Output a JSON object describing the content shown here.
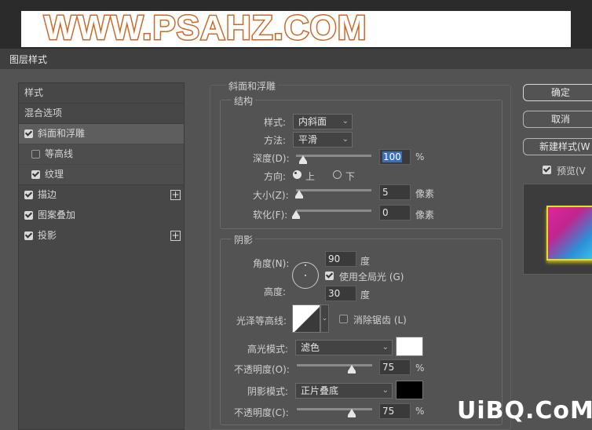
{
  "banner": {
    "text": "WWW.PSAHZ.COM"
  },
  "window": {
    "title": "图层样式"
  },
  "left_panel": {
    "items": [
      {
        "label": "样式"
      },
      {
        "label": "混合选项"
      },
      {
        "label": "斜面和浮雕",
        "checked": true
      },
      {
        "label": "等高线",
        "checked": false
      },
      {
        "label": "纹理",
        "checked": true
      },
      {
        "label": "描边",
        "checked": true
      },
      {
        "label": "图案叠加",
        "checked": true
      },
      {
        "label": "投影",
        "checked": true
      }
    ],
    "plus_icon": "plus-icon"
  },
  "bevel": {
    "section_title": "斜面和浮雕",
    "structure": {
      "title": "结构",
      "style_label": "样式:",
      "style_value": "内斜面",
      "method_label": "方法:",
      "method_value": "平滑",
      "depth_label": "深度(D):",
      "depth_value": "100",
      "depth_unit": "%",
      "depth_level": 0.1,
      "direction_label": "方向:",
      "direction_up": "上",
      "direction_down": "下",
      "size_label": "大小(Z):",
      "size_value": "5",
      "size_unit": "像素",
      "soften_label": "软化(F):",
      "soften_value": "0",
      "soften_unit": "像素"
    },
    "shading": {
      "title": "阴影",
      "angle_label": "角度(N):",
      "angle_value": "90",
      "angle_unit": "度",
      "global_light_label": "使用全局光 (G)",
      "altitude_label": "高度:",
      "altitude_value": "30",
      "altitude_unit": "度",
      "gloss_contour_label": "光泽等高线:",
      "anti_alias_label": "消除锯齿 (L)",
      "highlight_mode_label": "高光模式:",
      "highlight_mode_value": "滤色",
      "highlight_color": "#ffffff",
      "highlight_opacity_label": "不透明度(O):",
      "highlight_opacity_value": "75",
      "shadow_mode_label": "阴影模式:",
      "shadow_mode_value": "正片叠底",
      "shadow_color": "#000000",
      "shadow_opacity_label": "不透明度(C):",
      "shadow_opacity_value": "75",
      "opacity_unit": "%"
    }
  },
  "buttons": {
    "ok": "确定",
    "cancel": "取消",
    "new_style": "新建样式(W",
    "preview_label": "预览(V"
  },
  "watermark": {
    "text": "UiBQ.CoM"
  }
}
